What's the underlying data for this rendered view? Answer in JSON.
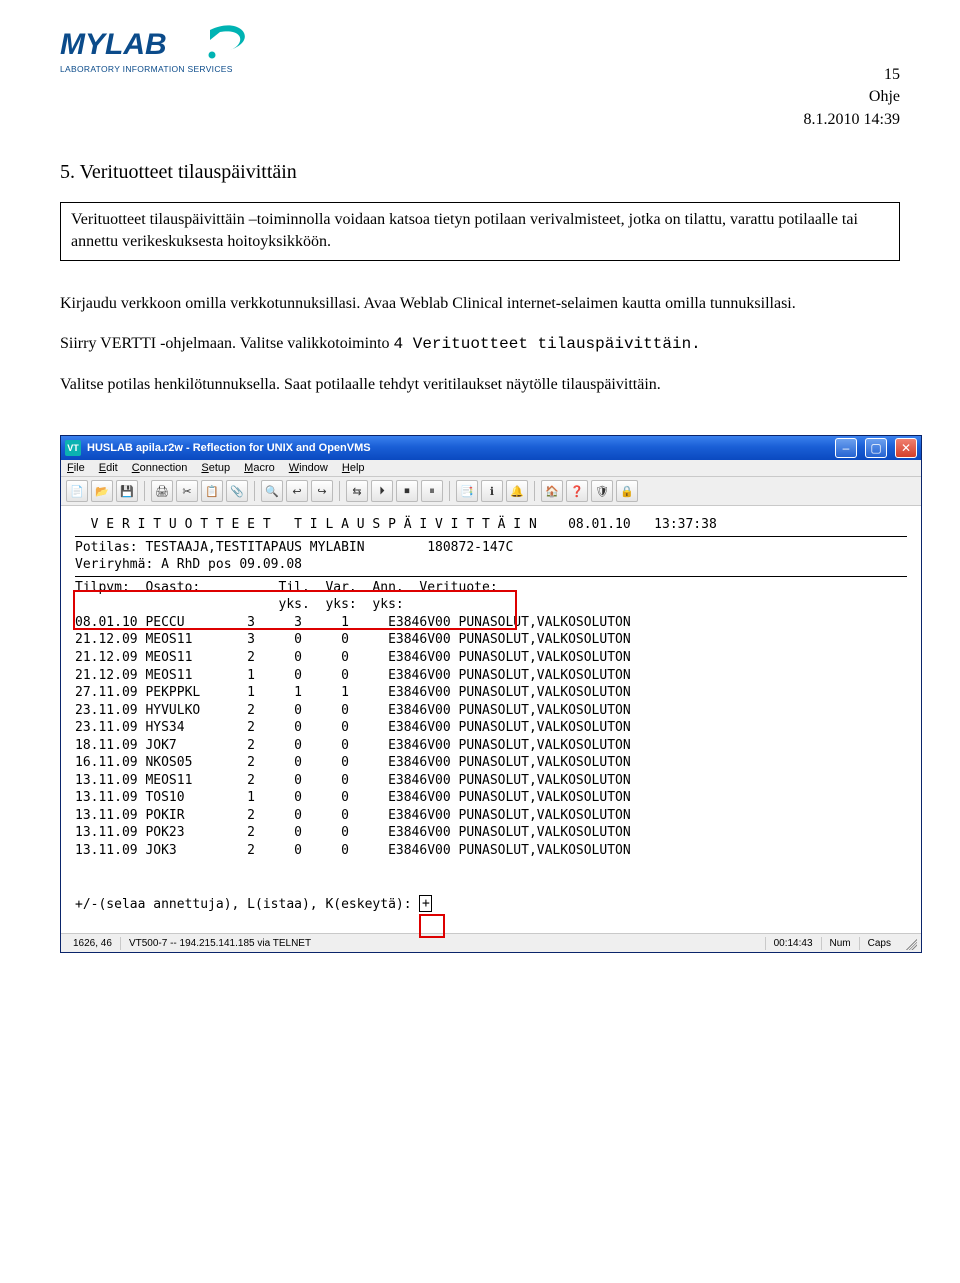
{
  "logo": {
    "name": "MYLAB",
    "tagline": "LABORATORY INFORMATION SERVICES"
  },
  "header": {
    "page_number": "15",
    "doc_type": "Ohje",
    "datetime": "8.1.2010 14:39"
  },
  "section": {
    "title": "5.   Verituotteet tilauspäivittäin",
    "info_box": "Verituotteet tilauspäivittäin –toiminnolla voidaan katsoa tietyn potilaan verivalmisteet, jotka on  tilattu, varattu  potilaalle tai annettu verikeskuksesta hoitoyksikköön.",
    "para1": "Kirjaudu verkkoon omilla verkkotunnuksillasi.  Avaa Weblab Clinical internet-selaimen kautta omilla tunnuksillasi.",
    "para2_pre": "Siirry VERTTI -ohjelmaan. Valitse  valikkotoiminto ",
    "para2_menu": "4 Verituotteet tilauspäivittäin.",
    "para3": "Valitse potilas  henkilötunnuksella.  Saat potilaalle tehdyt  veritilaukset näytölle tilauspäivittäin."
  },
  "terminal": {
    "title": "HUSLAB apila.r2w - Reflection for UNIX and OpenVMS",
    "menus": [
      "File",
      "Edit",
      "Connection",
      "Setup",
      "Macro",
      "Window",
      "Help"
    ],
    "toolbar_icons": [
      "📄",
      "📂",
      "💾",
      "🖨",
      "✂",
      "📋",
      "📎",
      "🔍",
      "↩",
      "↪",
      "⇆",
      "⏵",
      "⏹",
      "⏸",
      "📑",
      "ℹ",
      "🔔",
      "🏠",
      "❓",
      "🛡",
      "🔒"
    ],
    "screen": {
      "title_line": "V E R I T U O T T E E T   T I L A U S P Ä I V I T T Ä I N    08.01.10   13:37:38",
      "patient_label": "Potilas:",
      "patient_name": "TESTAAJA,TESTITAPAUS MYLABIN",
      "patient_id": "180872-147C",
      "bloodgroup_label": "Veriryhmä:",
      "bloodgroup_value": "A RhD pos 09.09.08",
      "col_header_1": "Tilpvm:  Osasto:          Til.  Var.  Ann.  Verituote:",
      "col_header_2": "                          yks.  yks:  yks:",
      "rows": [
        {
          "date": "08.01.10",
          "ward": "PECCU  ",
          "til": "3",
          "var": "3",
          "ann": "1",
          "prod": "E3846V00 PUNASOLUT,VALKOSOLUTON"
        },
        {
          "date": "21.12.09",
          "ward": "MEOS11 ",
          "til": "3",
          "var": "0",
          "ann": "0",
          "prod": "E3846V00 PUNASOLUT,VALKOSOLUTON"
        },
        {
          "date": "21.12.09",
          "ward": "MEOS11 ",
          "til": "2",
          "var": "0",
          "ann": "0",
          "prod": "E3846V00 PUNASOLUT,VALKOSOLUTON"
        },
        {
          "date": "21.12.09",
          "ward": "MEOS11 ",
          "til": "1",
          "var": "0",
          "ann": "0",
          "prod": "E3846V00 PUNASOLUT,VALKOSOLUTON"
        },
        {
          "date": "27.11.09",
          "ward": "PEKPPKL",
          "til": "1",
          "var": "1",
          "ann": "1",
          "prod": "E3846V00 PUNASOLUT,VALKOSOLUTON"
        },
        {
          "date": "23.11.09",
          "ward": "HYVULKO",
          "til": "2",
          "var": "0",
          "ann": "0",
          "prod": "E3846V00 PUNASOLUT,VALKOSOLUTON"
        },
        {
          "date": "23.11.09",
          "ward": "HYS34  ",
          "til": "2",
          "var": "0",
          "ann": "0",
          "prod": "E3846V00 PUNASOLUT,VALKOSOLUTON"
        },
        {
          "date": "18.11.09",
          "ward": "JOK7   ",
          "til": "2",
          "var": "0",
          "ann": "0",
          "prod": "E3846V00 PUNASOLUT,VALKOSOLUTON"
        },
        {
          "date": "16.11.09",
          "ward": "NKOS05 ",
          "til": "2",
          "var": "0",
          "ann": "0",
          "prod": "E3846V00 PUNASOLUT,VALKOSOLUTON"
        },
        {
          "date": "13.11.09",
          "ward": "MEOS11 ",
          "til": "2",
          "var": "0",
          "ann": "0",
          "prod": "E3846V00 PUNASOLUT,VALKOSOLUTON"
        },
        {
          "date": "13.11.09",
          "ward": "TOS10  ",
          "til": "1",
          "var": "0",
          "ann": "0",
          "prod": "E3846V00 PUNASOLUT,VALKOSOLUTON"
        },
        {
          "date": "13.11.09",
          "ward": "POKIR  ",
          "til": "2",
          "var": "0",
          "ann": "0",
          "prod": "E3846V00 PUNASOLUT,VALKOSOLUTON"
        },
        {
          "date": "13.11.09",
          "ward": "POK23  ",
          "til": "2",
          "var": "0",
          "ann": "0",
          "prod": "E3846V00 PUNASOLUT,VALKOSOLUTON"
        },
        {
          "date": "13.11.09",
          "ward": "JOK3   ",
          "til": "2",
          "var": "0",
          "ann": "0",
          "prod": "E3846V00 PUNASOLUT,VALKOSOLUTON"
        }
      ],
      "prompt": "+/-(selaa annettuja), L(istaa), K(eskeytä):",
      "prompt_value": "+"
    },
    "status": {
      "cursor": "1626, 46",
      "connection": "VT500-7 -- 194.215.141.185 via TELNET",
      "elapsed": "00:14:43",
      "num": "Num",
      "caps": "Caps"
    }
  }
}
